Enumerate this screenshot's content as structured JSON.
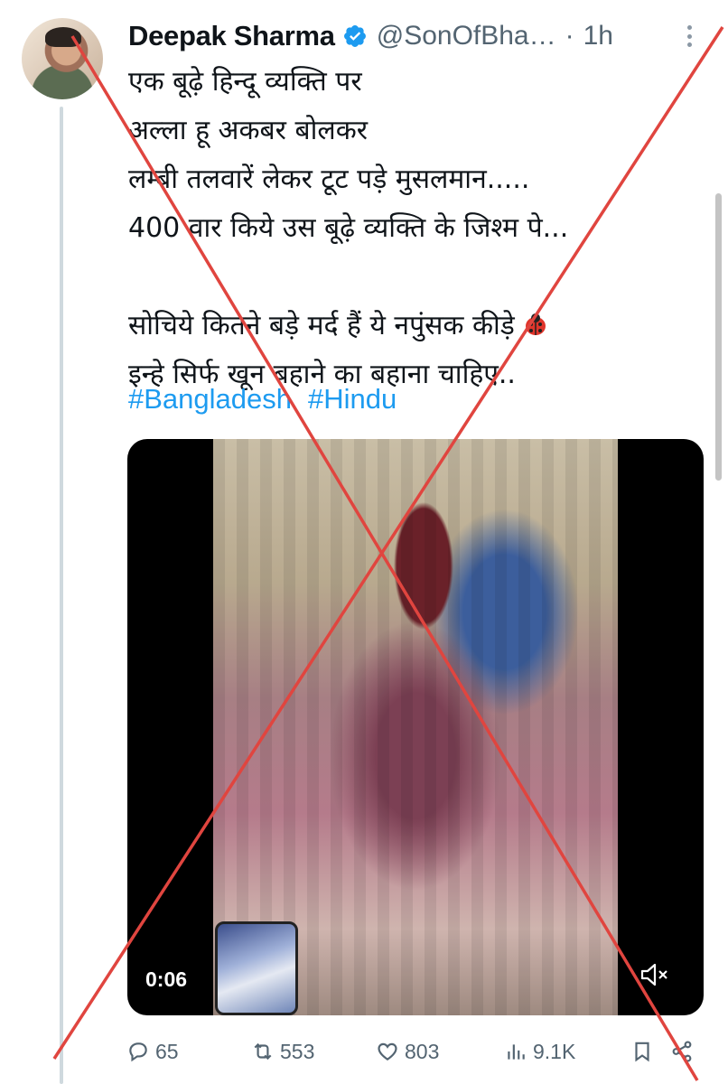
{
  "tweet": {
    "author_name": "Deepak Sharma",
    "handle": "@SonOfBha…",
    "separator": "·",
    "time": "1h",
    "lines": [
      "एक बूढ़े हिन्दू व्यक्ति पर",
      "अल्ला हू अकबर बोलकर",
      "लम्बी तलवारें लेकर टूट पड़े मुसलमान.....",
      "400 वार किये उस बूढ़े व्यक्ति के जिश्म पे...",
      "",
      "सोचिये कितने बड़े मर्द हैं ये नपुंसक कीड़े",
      "इन्हे सिर्फ खून बहाने का बहाना चाहिए.."
    ],
    "hashtags": [
      "#Bangladesh",
      "#Hindu"
    ],
    "video": {
      "duration": "0:06"
    },
    "stats": {
      "replies": "65",
      "reposts": "553",
      "likes": "803",
      "views": "9.1K"
    }
  },
  "icons": {
    "verified": "verified-badge-icon",
    "more": "more-options-icon",
    "reply": "reply-icon",
    "repost": "repost-icon",
    "like": "heart-icon",
    "views": "views-chart-icon",
    "bookmark": "bookmark-icon",
    "share": "share-icon",
    "mute": "muted-speaker-icon",
    "emoji": "ladybug-icon"
  },
  "colors": {
    "link": "#1d9bf0",
    "verified": "#1d9bf0",
    "muted_text": "#536471",
    "overlay_cross": "#e0453f"
  }
}
